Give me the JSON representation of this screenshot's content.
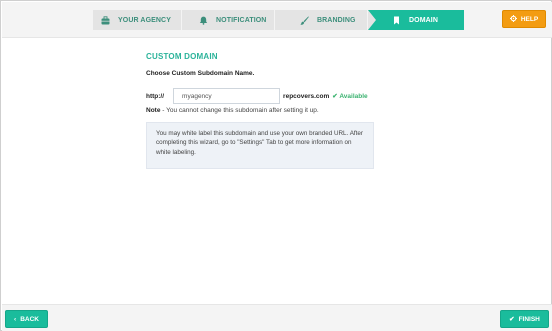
{
  "wizard": {
    "steps": [
      {
        "label": "YOUR AGENCY",
        "icon": "briefcase-icon",
        "active": false
      },
      {
        "label": "NOTIFICATION",
        "icon": "bell-icon",
        "active": false
      },
      {
        "label": "BRANDING",
        "icon": "brush-icon",
        "active": false
      },
      {
        "label": "DOMAIN",
        "icon": "bookmark-icon",
        "active": true
      }
    ],
    "help_label": "HELP",
    "help_icon": "gear-icon"
  },
  "domain": {
    "section_title": "CUSTOM DOMAIN",
    "subtitle": "Choose Custom Subdomain Name.",
    "prefix": "http://",
    "subdomain_value": "myagency",
    "domain_suffix": "repcovers.com",
    "availability": "Available",
    "note_label": "Note",
    "note_text": " - You cannot change this subdomain after setting it up.",
    "info_text": "You may white label this subdomain and use your own branded URL. After completing this wizard, go to \"Settings\" Tab to get more information on white labeling."
  },
  "footer": {
    "back_label": "BACK",
    "finish_label": "FINISH"
  },
  "colors": {
    "accent": "#1abc9c",
    "accent_text": "#2bb39a",
    "help": "#f39c12",
    "inactive_step": "#e4e4e4",
    "available": "#3cb371"
  }
}
